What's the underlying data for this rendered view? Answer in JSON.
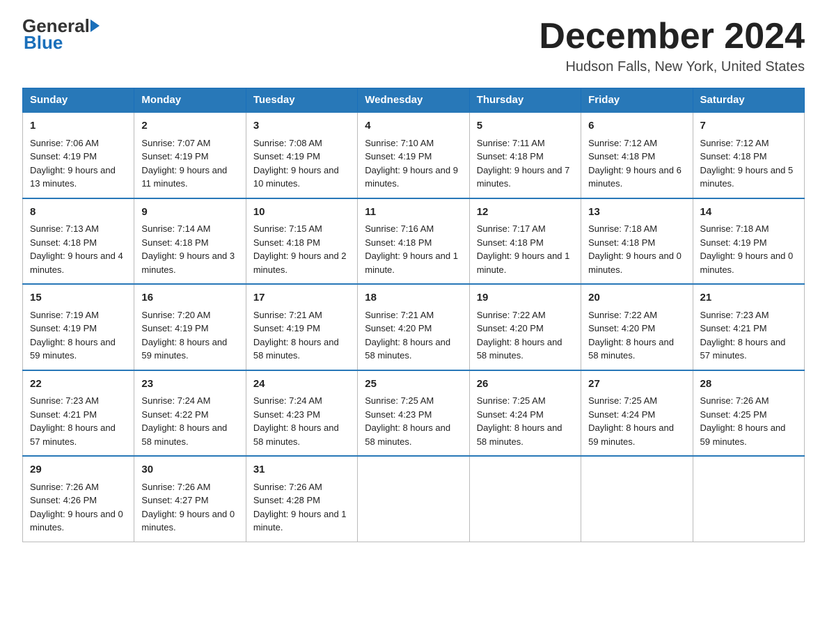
{
  "header": {
    "month_title": "December 2024",
    "location": "Hudson Falls, New York, United States"
  },
  "logo": {
    "line1": "General",
    "line2": "Blue"
  },
  "days_of_week": [
    "Sunday",
    "Monday",
    "Tuesday",
    "Wednesday",
    "Thursday",
    "Friday",
    "Saturday"
  ],
  "weeks": [
    [
      {
        "day": "1",
        "sunrise": "7:06 AM",
        "sunset": "4:19 PM",
        "daylight": "9 hours and 13 minutes."
      },
      {
        "day": "2",
        "sunrise": "7:07 AM",
        "sunset": "4:19 PM",
        "daylight": "9 hours and 11 minutes."
      },
      {
        "day": "3",
        "sunrise": "7:08 AM",
        "sunset": "4:19 PM",
        "daylight": "9 hours and 10 minutes."
      },
      {
        "day": "4",
        "sunrise": "7:10 AM",
        "sunset": "4:19 PM",
        "daylight": "9 hours and 9 minutes."
      },
      {
        "day": "5",
        "sunrise": "7:11 AM",
        "sunset": "4:18 PM",
        "daylight": "9 hours and 7 minutes."
      },
      {
        "day": "6",
        "sunrise": "7:12 AM",
        "sunset": "4:18 PM",
        "daylight": "9 hours and 6 minutes."
      },
      {
        "day": "7",
        "sunrise": "7:12 AM",
        "sunset": "4:18 PM",
        "daylight": "9 hours and 5 minutes."
      }
    ],
    [
      {
        "day": "8",
        "sunrise": "7:13 AM",
        "sunset": "4:18 PM",
        "daylight": "9 hours and 4 minutes."
      },
      {
        "day": "9",
        "sunrise": "7:14 AM",
        "sunset": "4:18 PM",
        "daylight": "9 hours and 3 minutes."
      },
      {
        "day": "10",
        "sunrise": "7:15 AM",
        "sunset": "4:18 PM",
        "daylight": "9 hours and 2 minutes."
      },
      {
        "day": "11",
        "sunrise": "7:16 AM",
        "sunset": "4:18 PM",
        "daylight": "9 hours and 1 minute."
      },
      {
        "day": "12",
        "sunrise": "7:17 AM",
        "sunset": "4:18 PM",
        "daylight": "9 hours and 1 minute."
      },
      {
        "day": "13",
        "sunrise": "7:18 AM",
        "sunset": "4:18 PM",
        "daylight": "9 hours and 0 minutes."
      },
      {
        "day": "14",
        "sunrise": "7:18 AM",
        "sunset": "4:19 PM",
        "daylight": "9 hours and 0 minutes."
      }
    ],
    [
      {
        "day": "15",
        "sunrise": "7:19 AM",
        "sunset": "4:19 PM",
        "daylight": "8 hours and 59 minutes."
      },
      {
        "day": "16",
        "sunrise": "7:20 AM",
        "sunset": "4:19 PM",
        "daylight": "8 hours and 59 minutes."
      },
      {
        "day": "17",
        "sunrise": "7:21 AM",
        "sunset": "4:19 PM",
        "daylight": "8 hours and 58 minutes."
      },
      {
        "day": "18",
        "sunrise": "7:21 AM",
        "sunset": "4:20 PM",
        "daylight": "8 hours and 58 minutes."
      },
      {
        "day": "19",
        "sunrise": "7:22 AM",
        "sunset": "4:20 PM",
        "daylight": "8 hours and 58 minutes."
      },
      {
        "day": "20",
        "sunrise": "7:22 AM",
        "sunset": "4:20 PM",
        "daylight": "8 hours and 58 minutes."
      },
      {
        "day": "21",
        "sunrise": "7:23 AM",
        "sunset": "4:21 PM",
        "daylight": "8 hours and 57 minutes."
      }
    ],
    [
      {
        "day": "22",
        "sunrise": "7:23 AM",
        "sunset": "4:21 PM",
        "daylight": "8 hours and 57 minutes."
      },
      {
        "day": "23",
        "sunrise": "7:24 AM",
        "sunset": "4:22 PM",
        "daylight": "8 hours and 58 minutes."
      },
      {
        "day": "24",
        "sunrise": "7:24 AM",
        "sunset": "4:23 PM",
        "daylight": "8 hours and 58 minutes."
      },
      {
        "day": "25",
        "sunrise": "7:25 AM",
        "sunset": "4:23 PM",
        "daylight": "8 hours and 58 minutes."
      },
      {
        "day": "26",
        "sunrise": "7:25 AM",
        "sunset": "4:24 PM",
        "daylight": "8 hours and 58 minutes."
      },
      {
        "day": "27",
        "sunrise": "7:25 AM",
        "sunset": "4:24 PM",
        "daylight": "8 hours and 59 minutes."
      },
      {
        "day": "28",
        "sunrise": "7:26 AM",
        "sunset": "4:25 PM",
        "daylight": "8 hours and 59 minutes."
      }
    ],
    [
      {
        "day": "29",
        "sunrise": "7:26 AM",
        "sunset": "4:26 PM",
        "daylight": "9 hours and 0 minutes."
      },
      {
        "day": "30",
        "sunrise": "7:26 AM",
        "sunset": "4:27 PM",
        "daylight": "9 hours and 0 minutes."
      },
      {
        "day": "31",
        "sunrise": "7:26 AM",
        "sunset": "4:28 PM",
        "daylight": "9 hours and 1 minute."
      },
      null,
      null,
      null,
      null
    ]
  ]
}
